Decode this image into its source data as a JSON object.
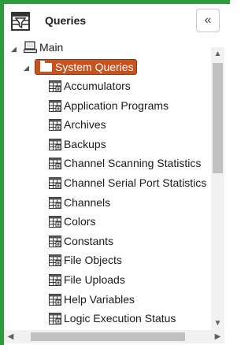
{
  "header": {
    "title": "Queries",
    "collapse_symbol": "«"
  },
  "tree": {
    "root": {
      "label": "Main",
      "expander": "◢"
    },
    "group": {
      "label": "System Queries",
      "expander": "◢"
    },
    "items": [
      "Accumulators",
      "Application Programs",
      "Archives",
      "Backups",
      "Channel Scanning Statistics",
      "Channel Serial Port Statistics",
      "Channels",
      "Colors",
      "Constants",
      "File Objects",
      "File Uploads",
      "Help Variables",
      "Logic Execution Status"
    ]
  },
  "scroll": {
    "up": "▲",
    "down": "▼",
    "left": "◀",
    "right": "▶"
  },
  "colors": {
    "accent": "#2e9a3b",
    "selected": "#c4531e"
  }
}
